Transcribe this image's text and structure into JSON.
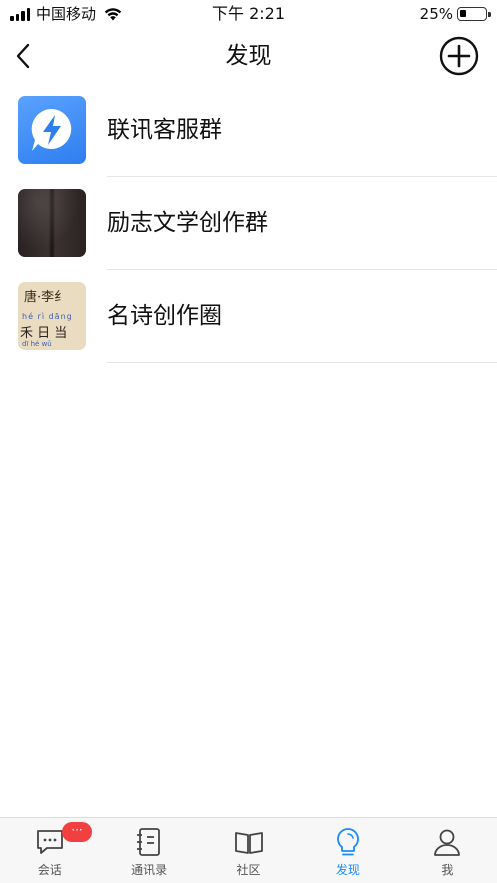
{
  "status_bar": {
    "carrier": "中国移动",
    "time": "下午 2:21",
    "battery": "25%",
    "battery_level": 0.25
  },
  "nav": {
    "title": "发现",
    "back_icon": "chevron-left-icon",
    "add_icon": "plus-circle-icon"
  },
  "items": [
    {
      "label": "联讯客服群",
      "thumb": "lightning-chat-icon"
    },
    {
      "label": "励志文学创作群",
      "thumb": "photo"
    },
    {
      "label": "名诗创作圈",
      "thumb": "photo",
      "thumb_text": {
        "line1": "唐·李纟",
        "pinyin1": "hé   rì  dāng",
        "line2": "禾 日 当",
        "pinyin2": "dī  hé  wǔ"
      }
    }
  ],
  "tabs": [
    {
      "label": "会话",
      "icon": "chat-icon",
      "badge": "···",
      "active": false
    },
    {
      "label": "通讯录",
      "icon": "contacts-icon",
      "active": false
    },
    {
      "label": "社区",
      "icon": "book-icon",
      "active": false
    },
    {
      "label": "发现",
      "icon": "bulb-icon",
      "active": true
    },
    {
      "label": "我",
      "icon": "person-icon",
      "active": false
    }
  ],
  "colors": {
    "accent": "#1a8cff",
    "badge": "#f24040",
    "thumb_blue": "#3a88f5"
  }
}
